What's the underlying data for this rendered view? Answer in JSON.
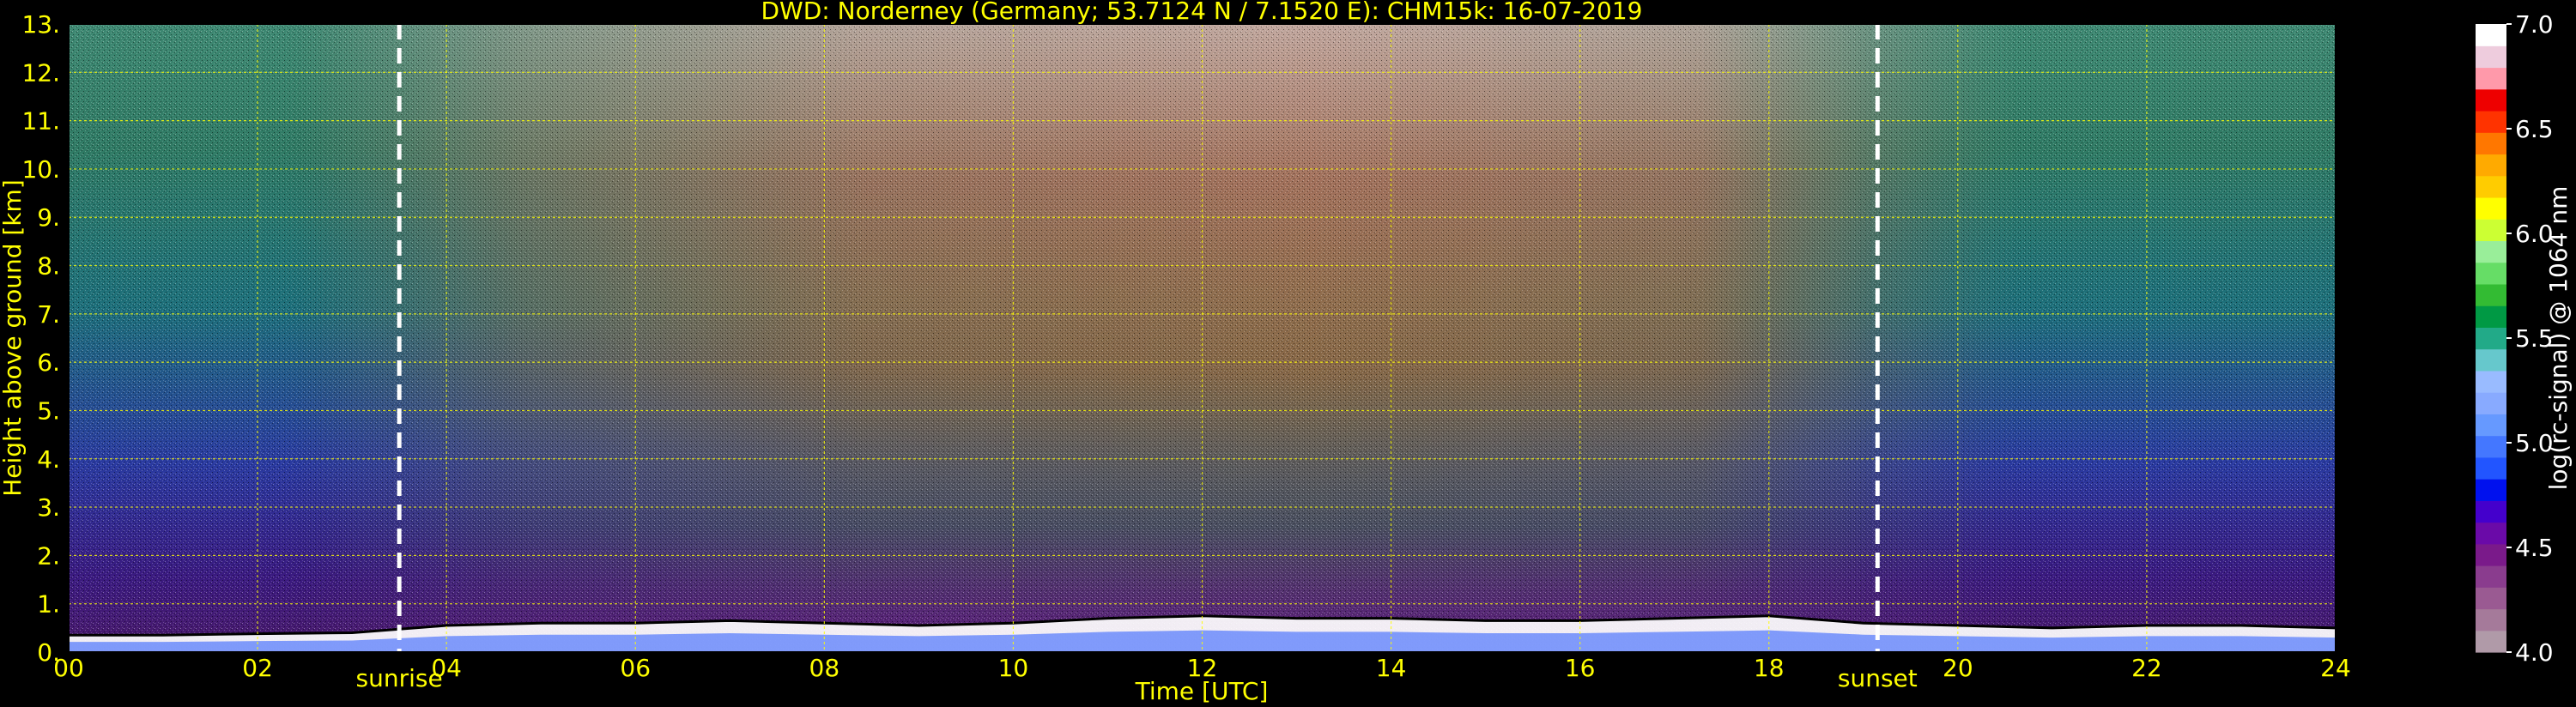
{
  "chart_data": {
    "type": "heatmap",
    "title": "DWD: Norderney (Germany; 53.7124 N / 7.1520 E):    CHM15k: 16-07-2019",
    "xlabel": "Time [UTC]",
    "ylabel": "Height above ground [km]",
    "xlim": [
      0,
      24
    ],
    "ylim": [
      0,
      13
    ],
    "x_ticks": [
      "00",
      "02",
      "04",
      "06",
      "08",
      "10",
      "12",
      "14",
      "16",
      "18",
      "20",
      "22",
      "24"
    ],
    "y_ticks": [
      "0.",
      "1.",
      "2.",
      "3.",
      "4.",
      "5.",
      "6.",
      "7.",
      "8.",
      "9.",
      "10.",
      "11.",
      "12.",
      "13."
    ],
    "grid": true,
    "grid_color": "#ffff00",
    "annotations": [
      {
        "label": "sunrise",
        "x": 3.5
      },
      {
        "label": "sunset",
        "x": 19.15
      }
    ],
    "colorbar": {
      "label": "log(rc-signal) @ 1064 nm",
      "range": [
        4.0,
        7.0
      ],
      "ticks": [
        "4.0",
        "4.5",
        "5.0",
        "5.5",
        "6.0",
        "6.5",
        "7.0"
      ],
      "colors": [
        "#b09aa8",
        "#a57a9a",
        "#9a5a92",
        "#8a3c8e",
        "#7a1a8a",
        "#6a0aa8",
        "#4400cc",
        "#0011ee",
        "#2255ff",
        "#4477ff",
        "#6699ff",
        "#88aaff",
        "#99bbff",
        "#66c8cc",
        "#22aa88",
        "#009944",
        "#33bb33",
        "#66dd66",
        "#99ee99",
        "#ccff33",
        "#ffff00",
        "#ffcc00",
        "#ffaa00",
        "#ff7700",
        "#ff3300",
        "#ee0000",
        "#ff99aa",
        "#eeccdd",
        "#ffffff"
      ]
    },
    "boundary_layer_height_km": [
      {
        "t": 0,
        "h": 0.35
      },
      {
        "t": 1,
        "h": 0.35
      },
      {
        "t": 2,
        "h": 0.38
      },
      {
        "t": 3,
        "h": 0.4
      },
      {
        "t": 4,
        "h": 0.55
      },
      {
        "t": 5,
        "h": 0.6
      },
      {
        "t": 6,
        "h": 0.6
      },
      {
        "t": 7,
        "h": 0.65
      },
      {
        "t": 8,
        "h": 0.6
      },
      {
        "t": 9,
        "h": 0.55
      },
      {
        "t": 10,
        "h": 0.6
      },
      {
        "t": 11,
        "h": 0.7
      },
      {
        "t": 12,
        "h": 0.75
      },
      {
        "t": 13,
        "h": 0.7
      },
      {
        "t": 14,
        "h": 0.7
      },
      {
        "t": 15,
        "h": 0.65
      },
      {
        "t": 16,
        "h": 0.65
      },
      {
        "t": 17,
        "h": 0.7
      },
      {
        "t": 18,
        "h": 0.75
      },
      {
        "t": 19,
        "h": 0.6
      },
      {
        "t": 20,
        "h": 0.55
      },
      {
        "t": 21,
        "h": 0.5
      },
      {
        "t": 22,
        "h": 0.55
      },
      {
        "t": 23,
        "h": 0.55
      },
      {
        "t": 24,
        "h": 0.5
      }
    ]
  }
}
